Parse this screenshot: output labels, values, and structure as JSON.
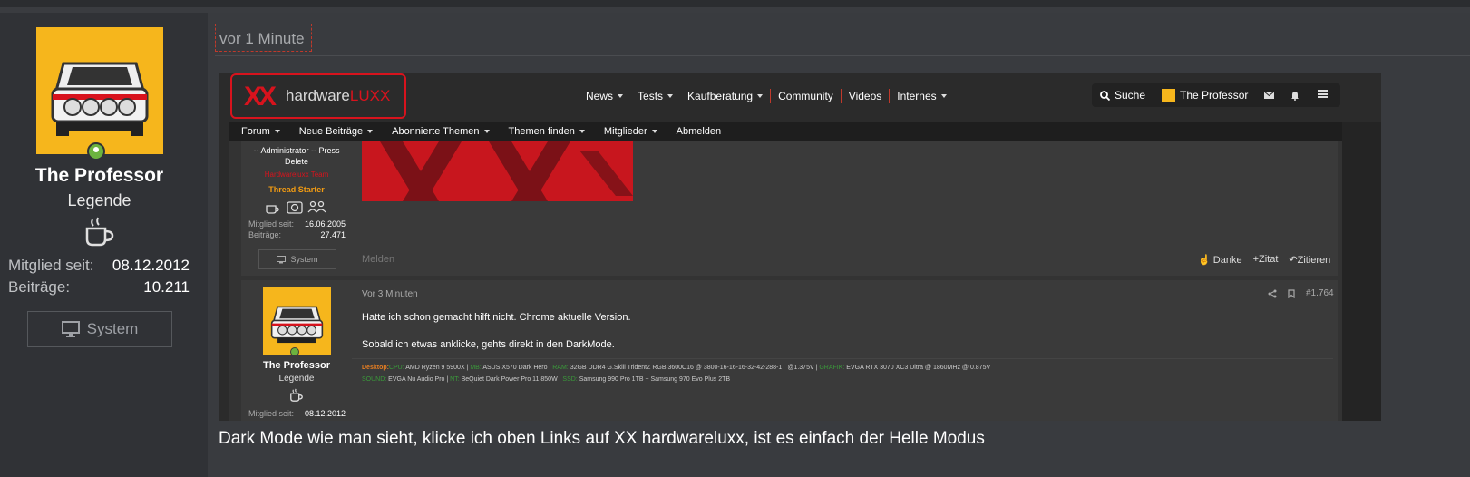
{
  "sidebar": {
    "user_name": "The Professor",
    "user_title": "Legende",
    "stats": [
      {
        "label": "Mitglied seit:",
        "value": "08.12.2012"
      },
      {
        "label": "Beiträge:",
        "value": "10.211"
      }
    ],
    "system_label": "System"
  },
  "post": {
    "time": "vor 1 Minute",
    "caption": "Dark Mode wie man sieht, klicke ich oben Links auf XX hardwareluxx, ist es einfach der Helle Modus"
  },
  "screenshot": {
    "logo_xx": "XX",
    "logo_text_a": "hardware",
    "logo_text_b": "LUXX",
    "nav": [
      "News",
      "Tests",
      "Kaufberatung",
      "Community",
      "Videos",
      "Internes"
    ],
    "search_label": "Suche",
    "account_name": "The Professor",
    "subnav": [
      "Forum",
      "Neue Beiträge",
      "Abonnierte Themen",
      "Themen finden",
      "Mitglieder",
      "Abmelden"
    ],
    "post1": {
      "role_line1": "-- Administrator -- Press",
      "role_line2": "Delete",
      "team": "Hardwareluxx Team",
      "thread_starter": "Thread Starter",
      "stats": [
        {
          "label": "Mitglied seit:",
          "value": "16.06.2005"
        },
        {
          "label": "Beiträge:",
          "value": "27.471"
        }
      ],
      "system_label": "System",
      "report_label": "Melden",
      "actions": [
        "Danke",
        "Zitat",
        "Zitieren"
      ]
    },
    "post2": {
      "time": "Vor 3 Minuten",
      "number": "#1.764",
      "user_name": "The Professor",
      "user_title": "Legende",
      "member_label": "Mitglied seit:",
      "member_value": "08.12.2012",
      "text1": "Hatte ich schon gemacht hilft nicht. Chrome aktuelle Version.",
      "text2": "Sobald ich etwas anklicke, gehts direkt in den DarkMode.",
      "sig1": [
        {
          "k": "Desktop:",
          "c": "o"
        },
        {
          "k": "CPU:",
          "c": "g"
        },
        {
          "k": " AMD Ryzen 9 5900X | ",
          "c": ""
        },
        {
          "k": "MB:",
          "c": "g"
        },
        {
          "k": " ASUS X570 Dark Hero | ",
          "c": ""
        },
        {
          "k": "RAM:",
          "c": "g"
        },
        {
          "k": " 32GB DDR4 G.Skill TridentZ RGB 3600C16 @ 3800-16-16-16-32-42-288-1T @1.375V | ",
          "c": ""
        },
        {
          "k": "GRAFIK:",
          "c": "g"
        },
        {
          "k": " EVGA RTX 3070 XC3 Ultra @ 1860MHz @ 0.875V",
          "c": ""
        }
      ],
      "sig2": [
        {
          "k": "SOUND:",
          "c": "g"
        },
        {
          "k": " EVGA Nu Audio Pro | ",
          "c": ""
        },
        {
          "k": "NT:",
          "c": "g"
        },
        {
          "k": " BeQuiet Dark Power Pro 11 850W | ",
          "c": ""
        },
        {
          "k": "SSD:",
          "c": "g"
        },
        {
          "k": " Samsung 990 Pro 1TB + Samsung 970 Evo Plus 2TB",
          "c": ""
        }
      ]
    }
  },
  "colors": {
    "accent": "#d8131d",
    "online": "#6cb33f",
    "avatar_bg": "#f6b61c"
  }
}
